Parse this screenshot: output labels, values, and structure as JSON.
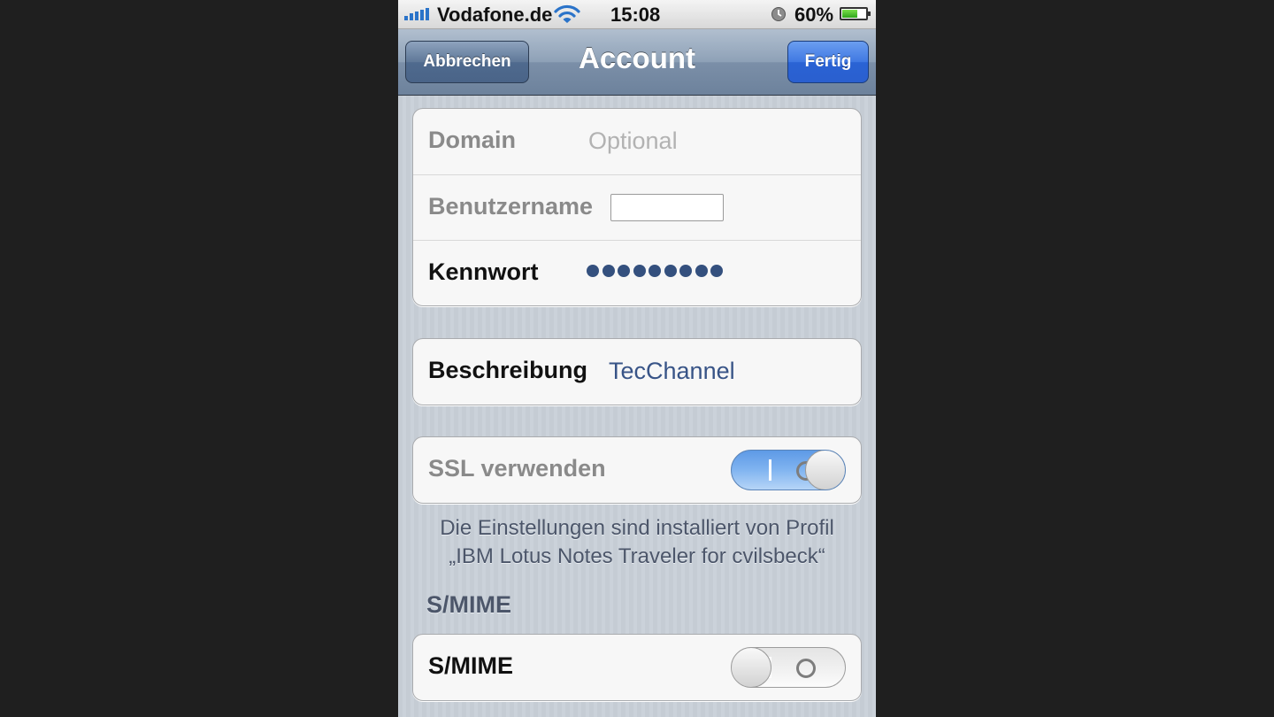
{
  "status_bar": {
    "carrier": "Vodafone.de",
    "time": "15:08",
    "battery_percent": "60%",
    "battery_level": 0.6,
    "icons": [
      "signal-icon",
      "wifi-icon",
      "alarm-icon",
      "battery-icon"
    ]
  },
  "nav": {
    "cancel_label": "Abbrechen",
    "title": "Account",
    "done_label": "Fertig"
  },
  "credentials": {
    "domain_label": "Domain",
    "domain_placeholder": "Optional",
    "username_label": "Benutzername",
    "username_value": "",
    "password_label": "Kennwort",
    "password_dot_count": 9
  },
  "description": {
    "label": "Beschreibung",
    "value": "TecChannel"
  },
  "ssl": {
    "label": "SSL verwenden",
    "enabled": true
  },
  "profile_note": {
    "line1": "Die Einstellungen sind installiert von Profil",
    "line2": "„IBM Lotus Notes Traveler for cvilsbeck“"
  },
  "smime_section": {
    "header": "S/MIME",
    "label": "S/MIME",
    "enabled": false
  },
  "colors": {
    "accent_blue": "#2a63d4",
    "value_text": "#385487",
    "switch_on": "#7fb3f0"
  }
}
